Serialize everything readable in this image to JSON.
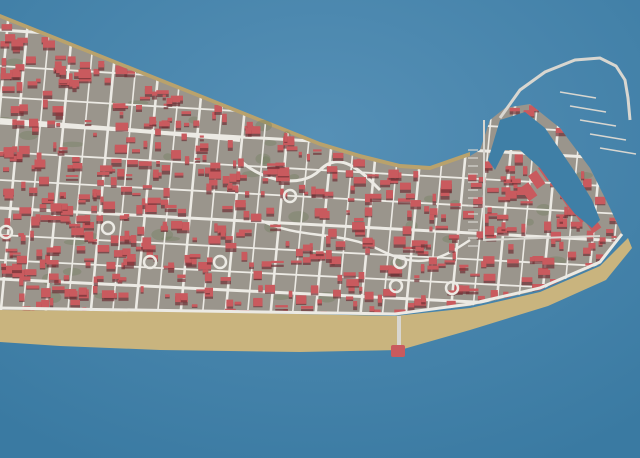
{
  "scene": {
    "kind": "3d-city-model",
    "view": "oblique aerial",
    "features": [
      "sea",
      "peninsula",
      "beach",
      "street-grid",
      "roundabouts",
      "buildings",
      "marina",
      "breakwater",
      "pier"
    ],
    "colors": {
      "sea": "#3f7fa6",
      "sea_light": "#5a98bf",
      "land": "#9a958c",
      "land_shadow": "#7d786f",
      "beach": "#c9b47e",
      "beach_dark": "#b9a26c",
      "streets": "#eceae4",
      "buildings": "#c95a5e",
      "buildings_shadow": "#6e3034",
      "jetty": "#d8d6d0",
      "vegetation": "#6d7a5a"
    },
    "marina_piers": 5,
    "roundabouts": 8
  }
}
